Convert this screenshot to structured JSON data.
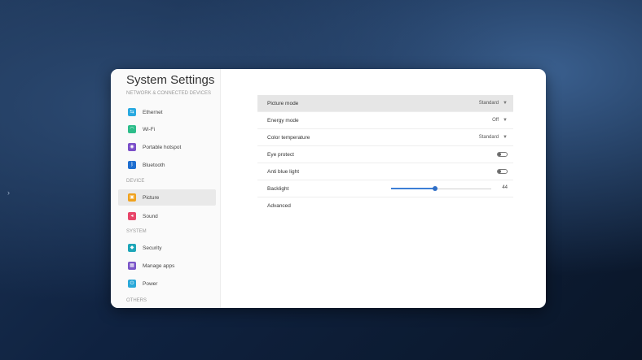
{
  "app": {
    "title": "System Settings"
  },
  "sidebar": {
    "sections": [
      {
        "header": "NETWORK & CONNECTED DEVICES"
      },
      {
        "header": "DEVICE"
      },
      {
        "header": "SYSTEM"
      },
      {
        "header": "OTHERS"
      }
    ],
    "items": [
      {
        "label": "Ethernet",
        "icon": "ethernet-icon",
        "color": "#29a9e0"
      },
      {
        "label": "Wi-Fi",
        "icon": "wifi-icon",
        "color": "#2dbd8a"
      },
      {
        "label": "Portable hotspot",
        "icon": "hotspot-icon",
        "color": "#7b4fc9"
      },
      {
        "label": "Bluetooth",
        "icon": "bluetooth-icon",
        "color": "#1f6fd0"
      },
      {
        "label": "Picture",
        "icon": "picture-icon",
        "color": "#f0a21e"
      },
      {
        "label": "Sound",
        "icon": "sound-icon",
        "color": "#e8466a"
      },
      {
        "label": "Security",
        "icon": "shield-icon",
        "color": "#1ea6b8"
      },
      {
        "label": "Manage apps",
        "icon": "apps-icon",
        "color": "#7a55c8"
      },
      {
        "label": "Power",
        "icon": "power-icon",
        "color": "#2aa8d8"
      }
    ]
  },
  "picture": {
    "rows": [
      {
        "label": "Picture mode",
        "value": "Standard"
      },
      {
        "label": "Energy mode",
        "value": "Off"
      },
      {
        "label": "Color temperature",
        "value": "Standard"
      },
      {
        "label": "Eye protect",
        "toggle": false
      },
      {
        "label": "Anti blue light",
        "toggle": false
      },
      {
        "label": "Backlight",
        "value": "44"
      },
      {
        "label": "Advanced"
      }
    ],
    "backlight_level": 0.44
  }
}
